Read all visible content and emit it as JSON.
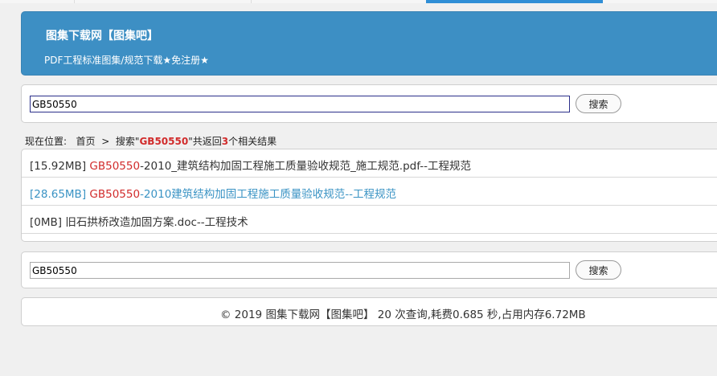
{
  "header": {
    "title": "图集下载网【图集吧】",
    "subtitle": "PDF工程标准图集/规范下载★免注册★"
  },
  "search_top": {
    "value": "GB50550",
    "button": "搜索"
  },
  "breadcrumb": {
    "prefix": "现在位置:",
    "home": "首页",
    "separator": ">",
    "search_label": "搜索\"",
    "keyword": "GB50550",
    "middle": "\"共返回",
    "count": "3",
    "suffix": "个相关结果"
  },
  "results": [
    {
      "size": "[15.92MB] ",
      "keyword": "GB50550",
      "rest": "-2010_建筑结构加固工程施工质量验收规范_施工规范.pdf--工程规范"
    },
    {
      "size": "[28.65MB] ",
      "keyword": "GB50550",
      "rest": "-2010建筑结构加固工程施工质量验收规范--工程规范"
    },
    {
      "size": "[0MB] ",
      "keyword": "",
      "rest": "旧石拱桥改造加固方案.doc--工程技术"
    }
  ],
  "search_bottom": {
    "value": "GB50550",
    "button": "搜索"
  },
  "footer": {
    "text": "© 2019  图集下载网【图集吧】  20 次查询,耗费0.685 秒,占用内存6.72MB"
  },
  "colors": {
    "header_bg": "#3d8fc4",
    "highlight": "#d12b2b",
    "link_blue": "#3a93c4",
    "tab_active": "#2f8ed6"
  }
}
